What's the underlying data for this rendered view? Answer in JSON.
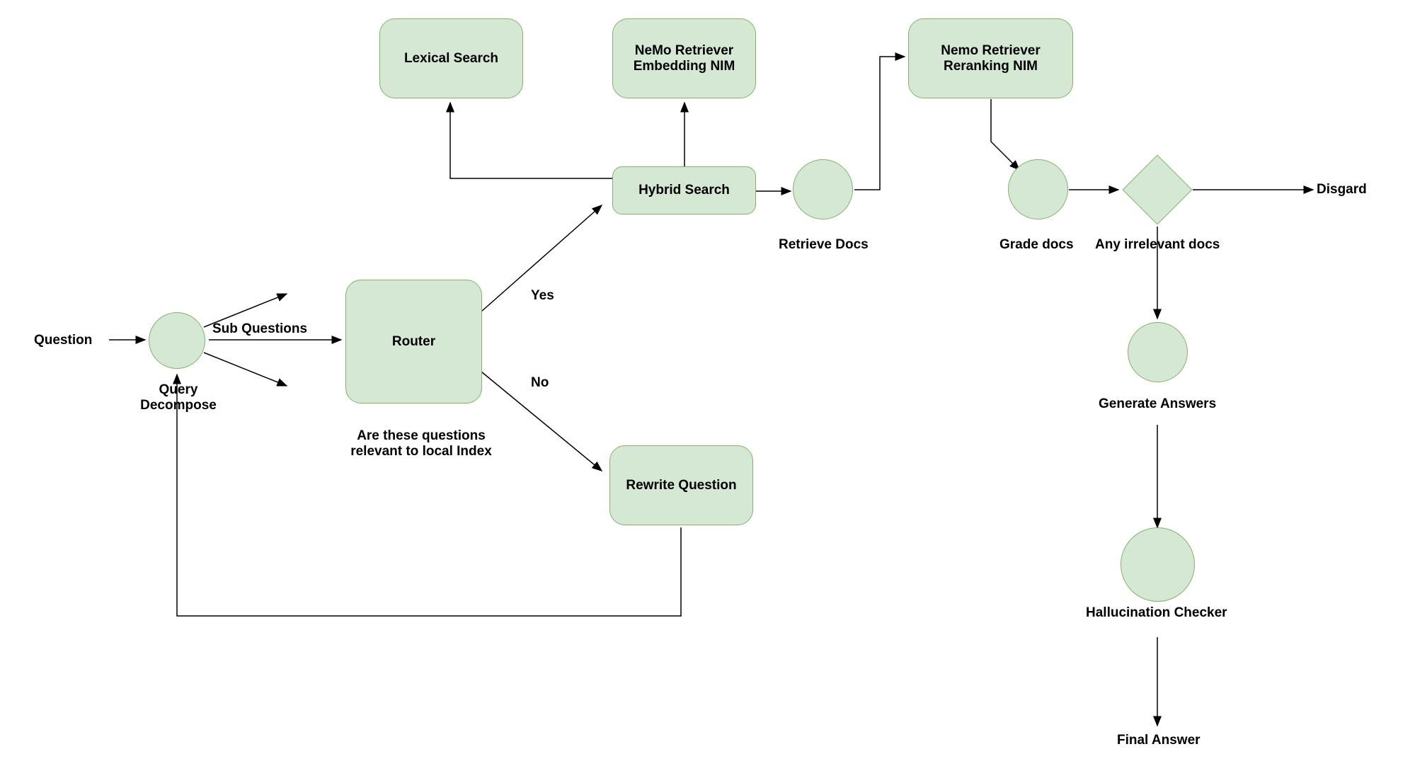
{
  "nodes": {
    "question": "Question",
    "query_decompose": "Query\nDecompose",
    "sub_questions": "Sub Questions",
    "router": "Router",
    "router_caption": "Are these questions\nrelevant to local Index",
    "yes": "Yes",
    "no": "No",
    "lexical_search": "Lexical Search",
    "nemo_embedding": "NeMo Retriever\nEmbedding NIM",
    "hybrid_search": "Hybrid Search",
    "rewrite_question": "Rewrite Question",
    "retrieve_docs": "Retrieve Docs",
    "nemo_reranking": "Nemo Retriever\nReranking NIM",
    "grade_docs": "Grade docs",
    "any_irrelevant": "Any irrelevant docs",
    "discard": "Disgard",
    "generate_answers": "Generate Answers",
    "hallucination_checker": "Hallucination Checker",
    "final_answer": "Final Answer"
  }
}
